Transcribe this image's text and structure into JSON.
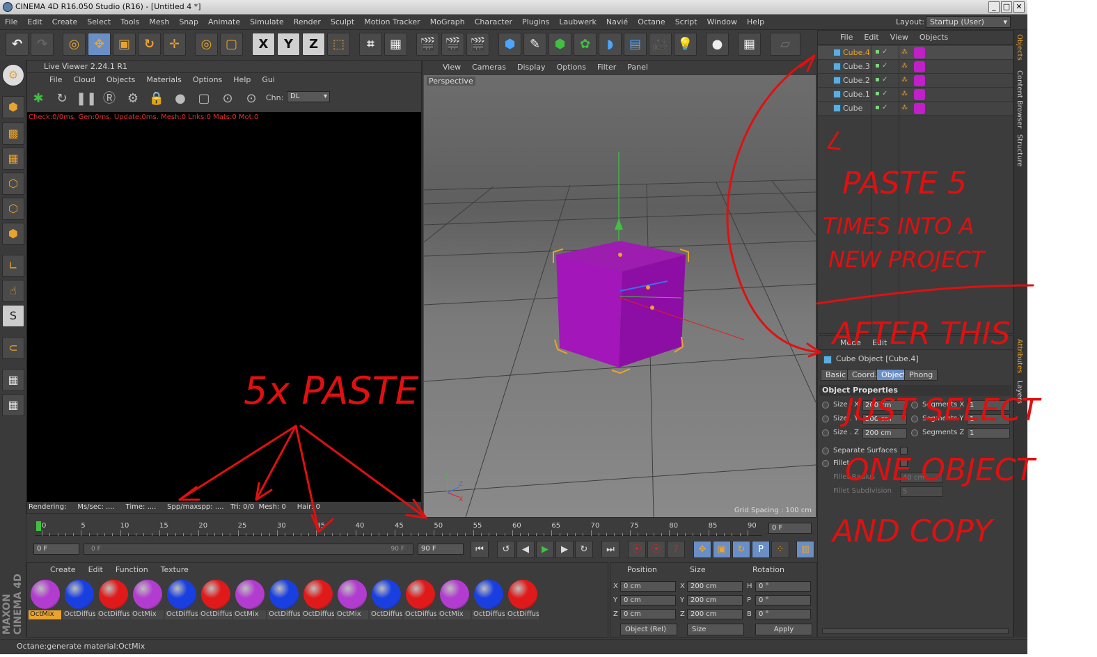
{
  "window": {
    "title": "CINEMA 4D R16.050 Studio (R16) - [Untitled 4 *]"
  },
  "menu": {
    "items": [
      "File",
      "Edit",
      "Create",
      "Select",
      "Tools",
      "Mesh",
      "Snap",
      "Animate",
      "Simulate",
      "Render",
      "Sculpt",
      "Motion Tracker",
      "MoGraph",
      "Character",
      "Plugins",
      "Laubwerk",
      "Navié",
      "Octane",
      "Script",
      "Window",
      "Help"
    ],
    "layout_label": "Layout:",
    "layout_value": "Startup (User)"
  },
  "live_viewer": {
    "title": "Live Viewer 2.24.1 R1",
    "menu": [
      "File",
      "Cloud",
      "Objects",
      "Materials",
      "Options",
      "Help",
      "Gui"
    ],
    "chn_label": "Chn:",
    "chn_value": "DL",
    "status_line": "Check:0/0ms. Gen:0ms. Update:0ms. Mesh:0 Lnks:0 Mats:0 Mot:0",
    "footer": "Rendering:     Ms/sec: ....     Time: ....     Spp/maxspp: ....   Tri: 0/0  Mesh: 0     Hair: 0"
  },
  "viewport": {
    "menu": [
      "View",
      "Cameras",
      "Display",
      "Options",
      "Filter",
      "Panel"
    ],
    "camera_label": "Perspective",
    "grid_spacing": "Grid Spacing : 100 cm"
  },
  "object_manager": {
    "menu": [
      "File",
      "Edit",
      "View",
      "Objects"
    ],
    "objects": [
      {
        "name": "Cube.4",
        "selected": true
      },
      {
        "name": "Cube.3",
        "selected": false
      },
      {
        "name": "Cube.2",
        "selected": false
      },
      {
        "name": "Cube.1",
        "selected": false
      },
      {
        "name": "Cube",
        "selected": false
      }
    ]
  },
  "right_tabs": [
    "Objects",
    "Content Browser",
    "Structure",
    "Attributes",
    "Layers"
  ],
  "attributes": {
    "menu": [
      "Mode",
      "Edit"
    ],
    "title": "Cube Object [Cube.4]",
    "tabs": [
      "Basic",
      "Coord.",
      "Object",
      "Phong"
    ],
    "active_tab": "Object",
    "section": "Object Properties",
    "props": {
      "size_x_label": "Size . X",
      "size_x": "200 cm",
      "size_y_label": "Size . Y",
      "size_y": "200 cm",
      "size_z_label": "Size . Z",
      "size_z": "200 cm",
      "seg_x_label": "Segments X",
      "seg_x": "1",
      "seg_y_label": "Segments Y",
      "seg_y": "1",
      "seg_z_label": "Segments Z",
      "seg_z": "1",
      "separate_label": "Separate Surfaces",
      "fillet_label": "Fillet",
      "fillet_radius_label": "Fillet Radius",
      "fillet_radius": "40 cm",
      "fillet_sub_label": "Fillet Subdivision",
      "fillet_sub": "5"
    }
  },
  "timeline": {
    "ticks": [
      "0",
      "5",
      "10",
      "15",
      "20",
      "25",
      "30",
      "35",
      "40",
      "45",
      "50",
      "55",
      "60",
      "65",
      "70",
      "75",
      "80",
      "85",
      "90"
    ],
    "current_frame": "0 F"
  },
  "playback": {
    "start": "0 F",
    "range_start": "0 F",
    "range_end": "90 F",
    "end": "90 F"
  },
  "materials": {
    "menu": [
      "Create",
      "Edit",
      "Function",
      "Texture"
    ],
    "items": [
      {
        "label": "OctMix",
        "color": "#b23ccf"
      },
      {
        "label": "OctDiffus",
        "color": "#1a3fe0"
      },
      {
        "label": "OctDiffus",
        "color": "#e01a1a"
      },
      {
        "label": "OctMix",
        "color": "#b23ccf"
      },
      {
        "label": "OctDiffus",
        "color": "#1a3fe0"
      },
      {
        "label": "OctDiffus",
        "color": "#e01a1a"
      },
      {
        "label": "OctMix",
        "color": "#b23ccf"
      },
      {
        "label": "OctDiffus",
        "color": "#1a3fe0"
      },
      {
        "label": "OctDiffus",
        "color": "#e01a1a"
      },
      {
        "label": "OctMix",
        "color": "#b23ccf"
      },
      {
        "label": "OctDiffus",
        "color": "#1a3fe0"
      },
      {
        "label": "OctDiffus",
        "color": "#e01a1a"
      },
      {
        "label": "OctMix",
        "color": "#b23ccf"
      },
      {
        "label": "OctDiffus",
        "color": "#1a3fe0"
      },
      {
        "label": "OctDiffus",
        "color": "#e01a1a"
      }
    ]
  },
  "coordinates": {
    "headers": [
      "Position",
      "Size",
      "Rotation"
    ],
    "rows": [
      {
        "axis": "X",
        "pos": "0 cm",
        "size_axis": "X",
        "size": "200 cm",
        "rot_axis": "H",
        "rot": "0 °"
      },
      {
        "axis": "Y",
        "pos": "0 cm",
        "size_axis": "Y",
        "size": "200 cm",
        "rot_axis": "P",
        "rot": "0 °"
      },
      {
        "axis": "Z",
        "pos": "0 cm",
        "size_axis": "Z",
        "size": "200 cm",
        "rot_axis": "B",
        "rot": "0 °"
      }
    ],
    "mode": "Object (Rel)",
    "size_mode": "Size",
    "apply": "Apply"
  },
  "status": "Octane:generate material:OctMix",
  "brand": "MAXON CINEMA 4D",
  "annotations": {
    "paste5": "5x PASTE",
    "right_text": [
      "PASTE 5",
      "TIMES INTO A",
      "NEW PROJECT",
      "AFTER THIS",
      "JUST SELECT",
      "ONE OBJECT",
      "AND COPY"
    ]
  },
  "colors": {
    "accent": "#e9a32e",
    "selection": "#6a8fc6",
    "annotation": "#e01010",
    "cube": "#b000c0"
  }
}
